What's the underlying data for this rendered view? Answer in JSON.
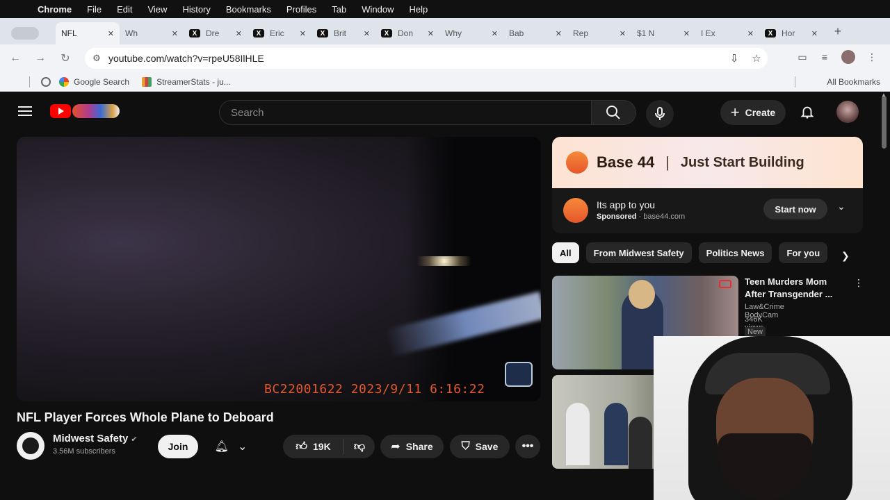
{
  "menubar": {
    "app": "Chrome",
    "items": [
      "File",
      "Edit",
      "View",
      "History",
      "Bookmarks",
      "Profiles",
      "Tab",
      "Window",
      "Help"
    ]
  },
  "tabs": [
    {
      "label": "NFL",
      "favicon": "youtube-icon",
      "active": true
    },
    {
      "label": "Wh",
      "favicon": "youtube-icon"
    },
    {
      "label": "Dre",
      "favicon": "x-icon"
    },
    {
      "label": "Eric",
      "favicon": "x-icon"
    },
    {
      "label": "Brit",
      "favicon": "x-icon"
    },
    {
      "label": "Don",
      "favicon": "x-icon"
    },
    {
      "label": "Why",
      "favicon": "youtube-icon"
    },
    {
      "label": "Bab",
      "favicon": "youtube-icon"
    },
    {
      "label": "Rep",
      "favicon": "youtube-icon"
    },
    {
      "label": "$1 N",
      "favicon": "youtube-icon"
    },
    {
      "label": "I Ex",
      "favicon": "youtube-icon"
    },
    {
      "label": "Hor",
      "favicon": "x-icon"
    }
  ],
  "omnibox": {
    "url": "youtube.com/watch?v=rpeU58IlHLE"
  },
  "bookmarks": {
    "items": [
      "Google Search",
      "StreamerStats - ju..."
    ],
    "all": "All Bookmarks"
  },
  "youtube": {
    "search_placeholder": "Search",
    "create_label": "Create",
    "video": {
      "overlay_text": "BC22001622   2023/9/11   6:16:22",
      "title": "NFL Player Forces Whole Plane to Deboard",
      "channel": "Midwest Safety",
      "subscribers": "3.56M subscribers",
      "join_label": "Join",
      "likes": "19K",
      "share_label": "Share",
      "save_label": "Save"
    },
    "ad": {
      "brand": "Base 44",
      "tagline": "Just Start Building",
      "headline": "Its app to you",
      "sponsored": "Sponsored",
      "domain": "base44.com",
      "cta": "Start now"
    },
    "chips": [
      "All",
      "From Midwest Safety",
      "Politics News",
      "For you"
    ],
    "recommendations": [
      {
        "title": "Teen Murders Mom After Transgender ...",
        "channel": "Law&Crime BodyCam",
        "meta": "346K views · 2 days ago",
        "badge": "New"
      }
    ]
  },
  "colors": {
    "youtube_red": "#ff0000",
    "page_bg": "#0f0f0f",
    "timestamp_orange": "#e2572b"
  }
}
